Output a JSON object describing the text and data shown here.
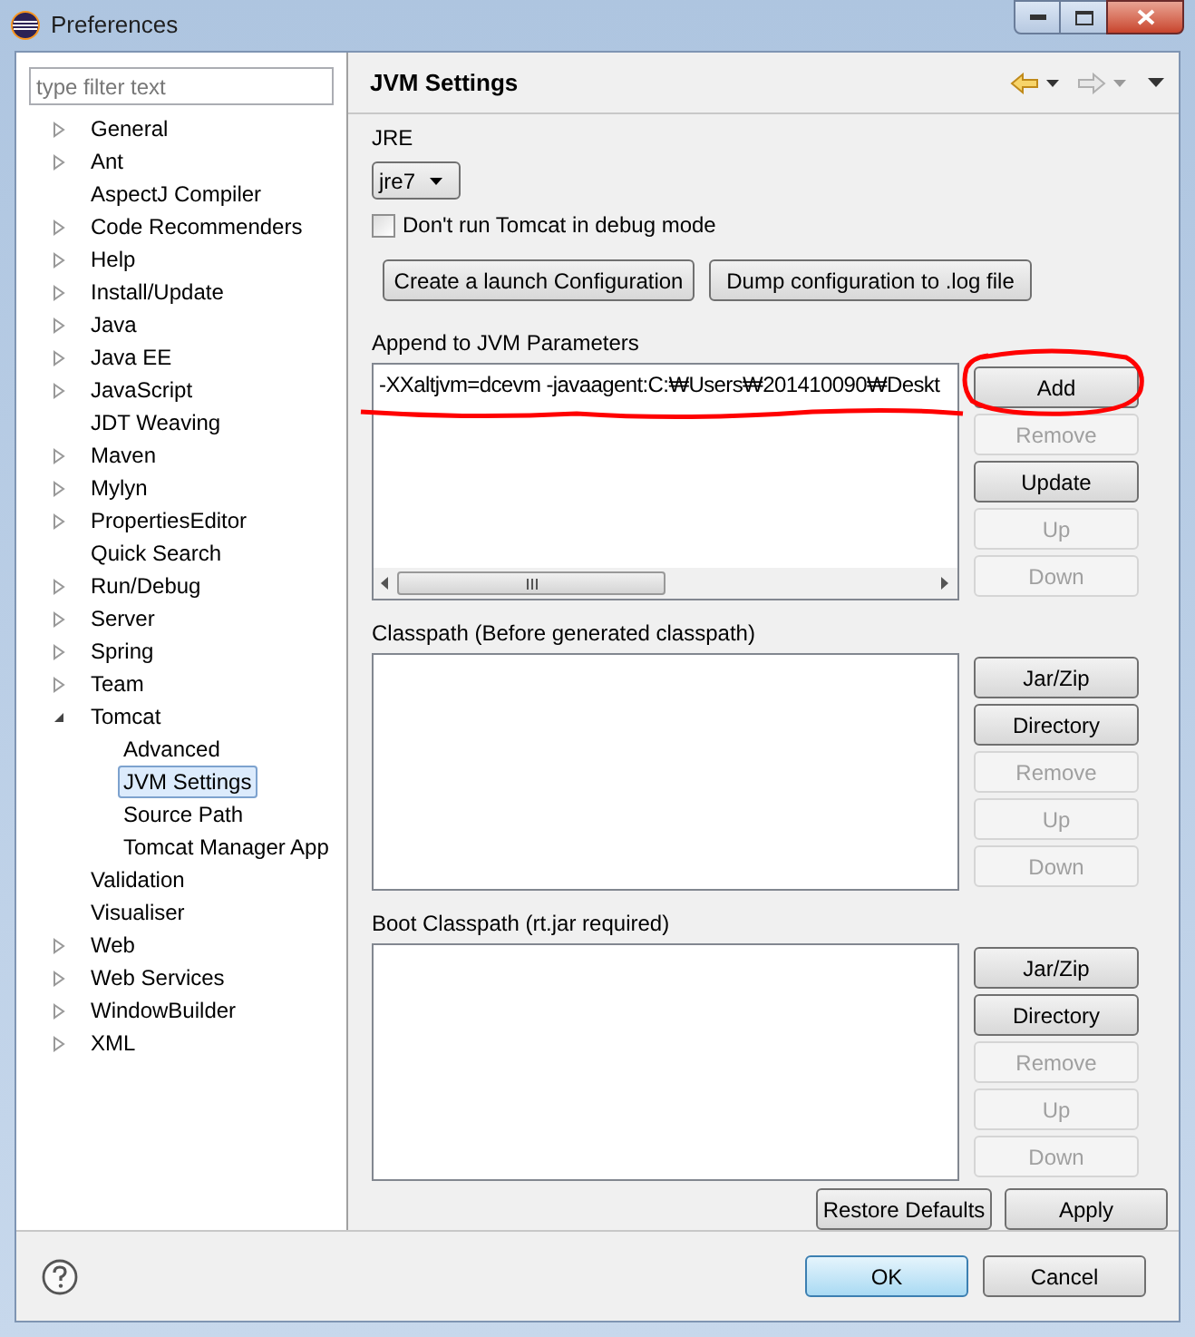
{
  "window": {
    "title": "Preferences"
  },
  "filter": {
    "placeholder": "type filter text"
  },
  "tree": [
    {
      "label": "General",
      "expanded": false,
      "selected": false
    },
    {
      "label": "Ant",
      "expanded": false,
      "selected": false
    },
    {
      "label": "AspectJ Compiler",
      "selected": false
    },
    {
      "label": "Code Recommenders",
      "expanded": false,
      "selected": false
    },
    {
      "label": "Help",
      "expanded": false,
      "selected": false
    },
    {
      "label": "Install/Update",
      "expanded": false,
      "selected": false
    },
    {
      "label": "Java",
      "expanded": false,
      "selected": false
    },
    {
      "label": "Java EE",
      "expanded": false,
      "selected": false
    },
    {
      "label": "JavaScript",
      "expanded": false,
      "selected": false
    },
    {
      "label": "JDT Weaving",
      "selected": false
    },
    {
      "label": "Maven",
      "expanded": false,
      "selected": false
    },
    {
      "label": "Mylyn",
      "expanded": false,
      "selected": false
    },
    {
      "label": "PropertiesEditor",
      "expanded": false,
      "selected": false
    },
    {
      "label": "Quick Search",
      "selected": false
    },
    {
      "label": "Run/Debug",
      "expanded": false,
      "selected": false
    },
    {
      "label": "Server",
      "expanded": false,
      "selected": false
    },
    {
      "label": "Spring",
      "expanded": false,
      "selected": false
    },
    {
      "label": "Team",
      "expanded": false,
      "selected": false
    },
    {
      "label": "Tomcat",
      "expanded": true,
      "selected": false,
      "children": [
        {
          "label": "Advanced",
          "selected": false
        },
        {
          "label": "JVM Settings",
          "selected": true
        },
        {
          "label": "Source Path",
          "selected": false
        },
        {
          "label": "Tomcat Manager App",
          "selected": false
        }
      ]
    },
    {
      "label": "Validation",
      "selected": false
    },
    {
      "label": "Visualiser",
      "selected": false
    },
    {
      "label": "Web",
      "expanded": false,
      "selected": false
    },
    {
      "label": "Web Services",
      "expanded": false,
      "selected": false
    },
    {
      "label": "WindowBuilder",
      "expanded": false,
      "selected": false
    },
    {
      "label": "XML",
      "expanded": false,
      "selected": false
    }
  ],
  "page": {
    "title": "JVM Settings",
    "jre_label": "JRE",
    "jre_value": "jre7",
    "debug_checkbox": {
      "label": "Don't run Tomcat in debug mode",
      "checked": false
    },
    "actions": [
      "Create a launch Configuration",
      "Dump configuration to .log file"
    ],
    "lists": [
      {
        "label": "Append to JVM Parameters",
        "items": [
          "-XXaltjvm=dcevm -javaagent:C:₩Users₩201410090₩Deskt"
        ],
        "horizontal_scroll": true,
        "buttons": [
          {
            "label": "Add",
            "disabled": false
          },
          {
            "label": "Remove",
            "disabled": true
          },
          {
            "label": "Update",
            "disabled": false
          },
          {
            "label": "Up",
            "disabled": true
          },
          {
            "label": "Down",
            "disabled": true
          }
        ]
      },
      {
        "label": "Classpath (Before generated classpath)",
        "buttons": [
          {
            "label": "Jar/Zip",
            "disabled": false
          },
          {
            "label": "Directory",
            "disabled": false
          },
          {
            "label": "Remove",
            "disabled": true
          },
          {
            "label": "Up",
            "disabled": true
          },
          {
            "label": "Down",
            "disabled": true
          }
        ]
      },
      {
        "label": "Boot Classpath (rt.jar required)",
        "buttons": [
          {
            "label": "Jar/Zip",
            "disabled": false
          },
          {
            "label": "Directory",
            "disabled": false
          },
          {
            "label": "Remove",
            "disabled": true
          },
          {
            "label": "Up",
            "disabled": true
          },
          {
            "label": "Down",
            "disabled": true
          }
        ]
      }
    ],
    "restore_button": "Restore Defaults",
    "apply_button": "Apply"
  },
  "footer": {
    "ok": "OK",
    "cancel": "Cancel"
  }
}
